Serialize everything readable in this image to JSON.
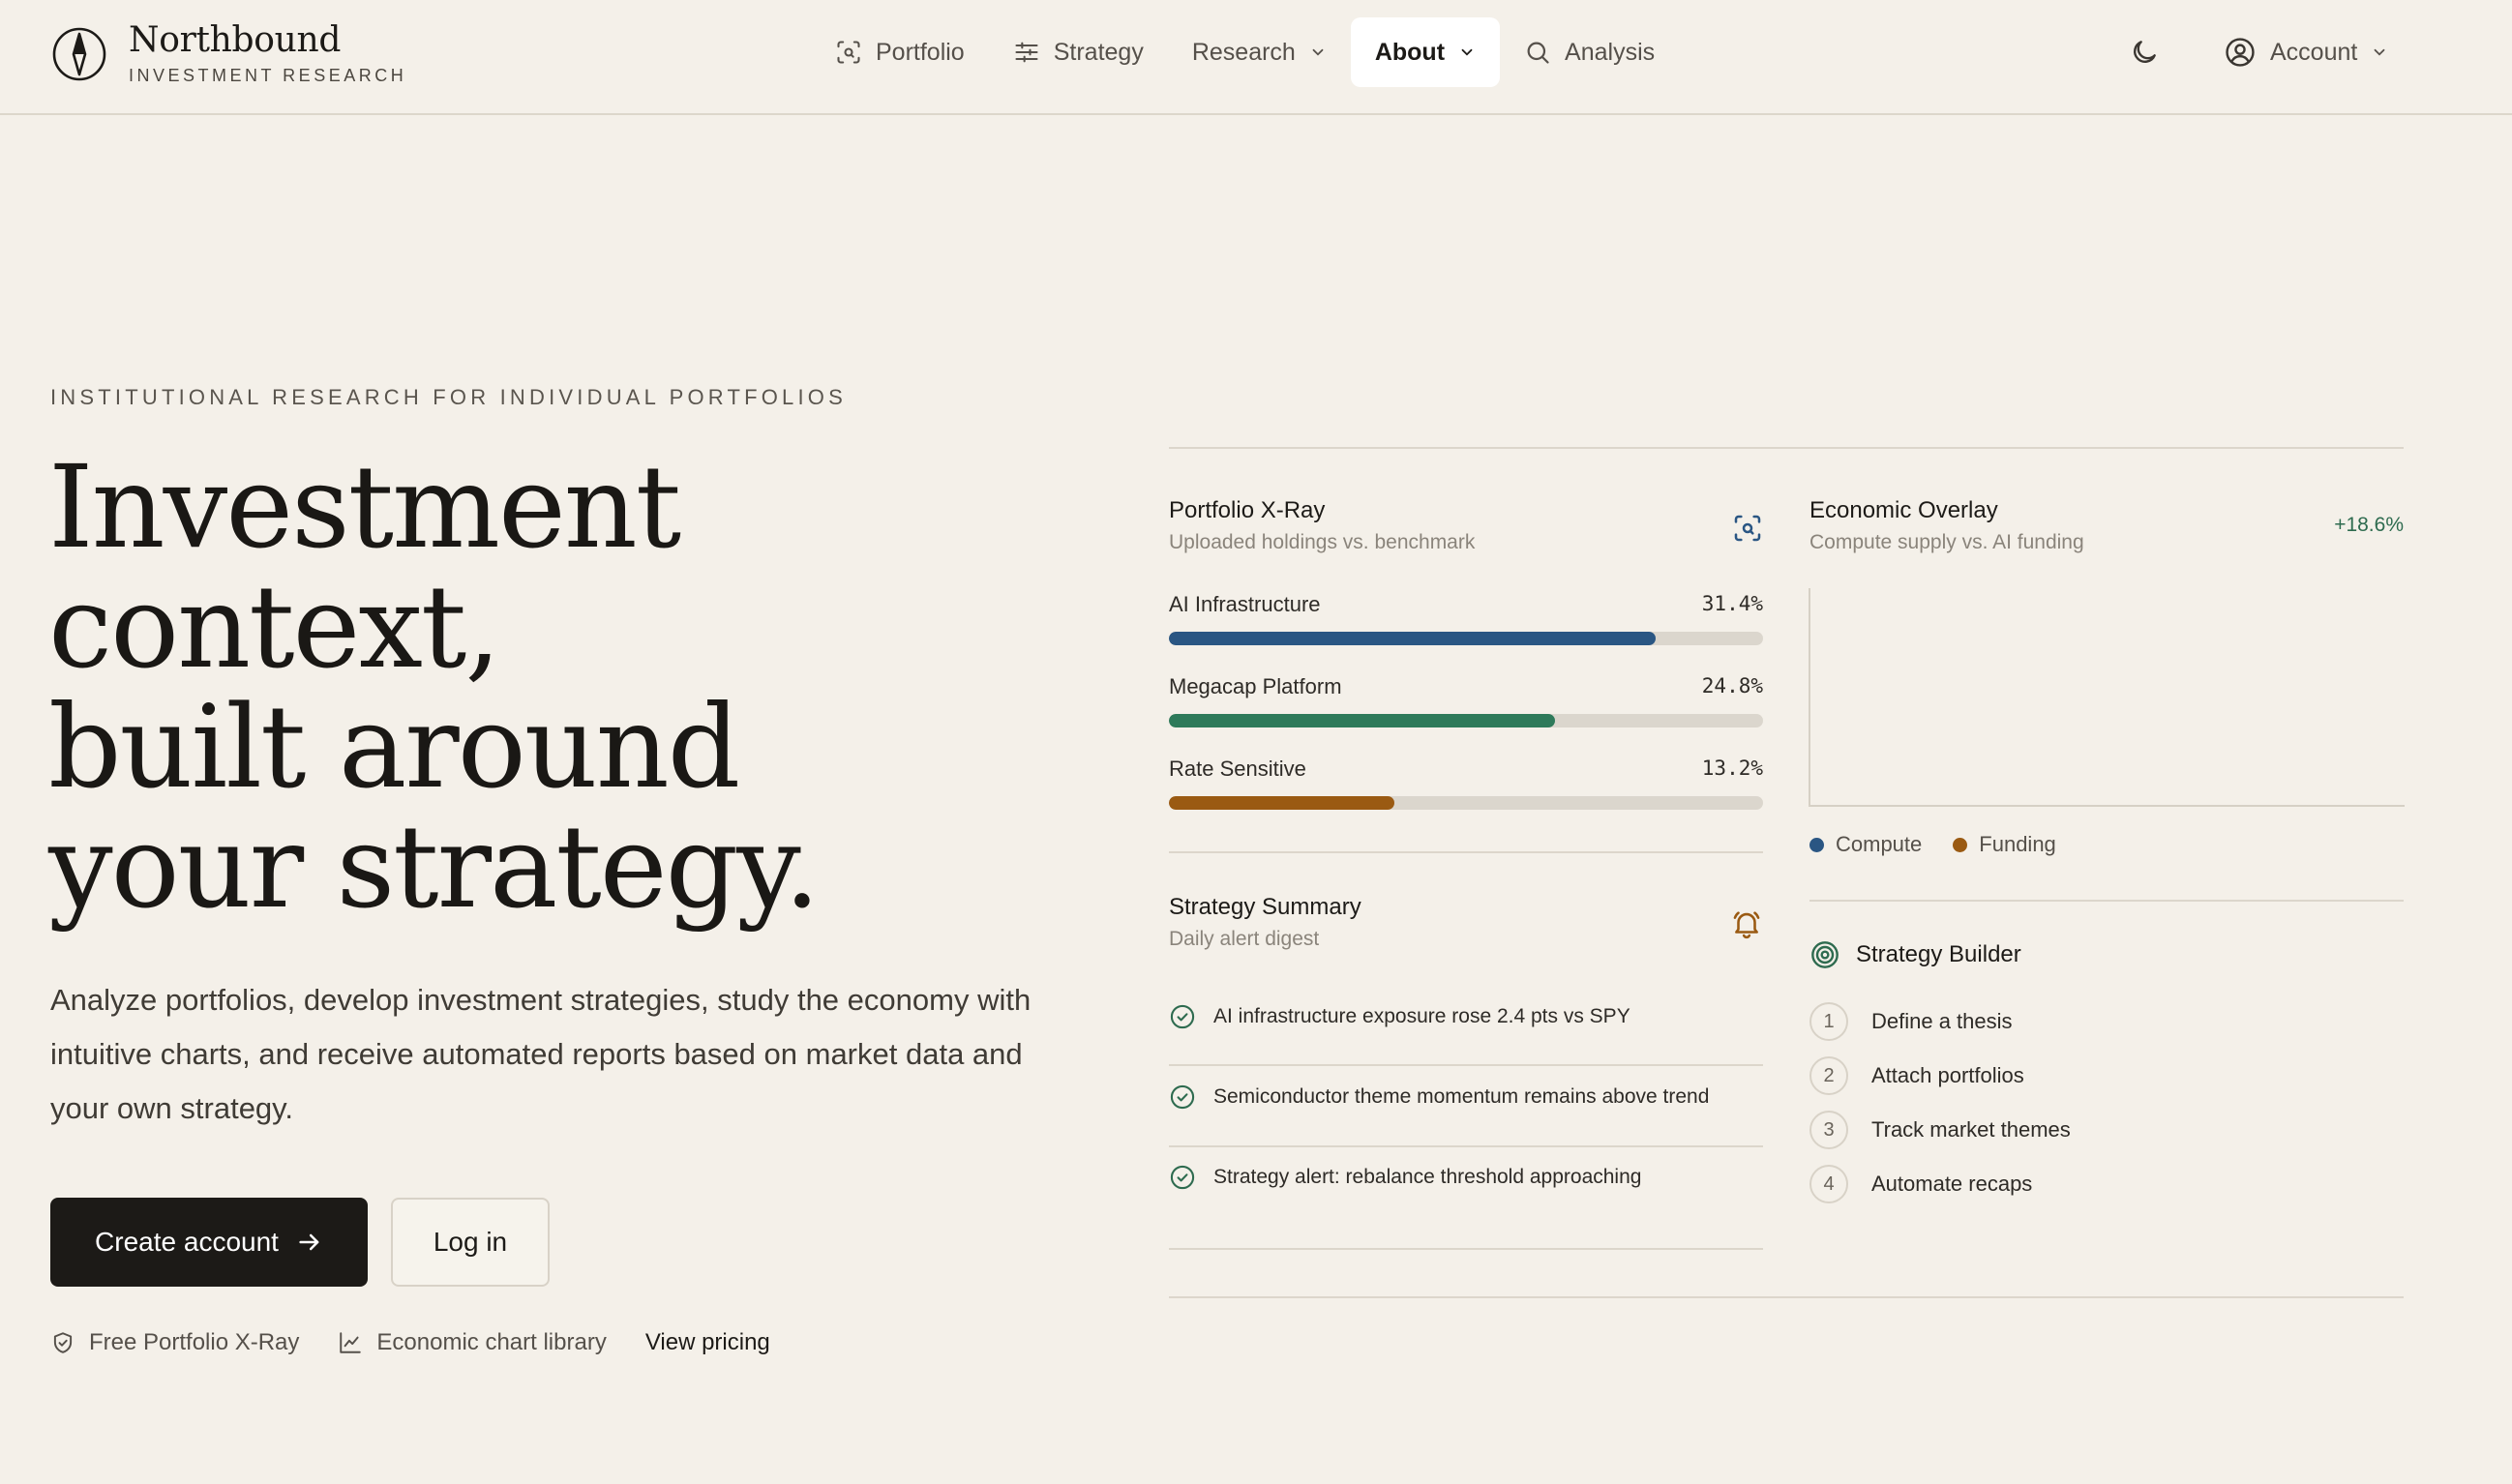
{
  "brand": {
    "name": "Northbound",
    "tagline": "INVESTMENT RESEARCH"
  },
  "nav": {
    "items": [
      {
        "label": "Portfolio",
        "icon": "scan-search-icon"
      },
      {
        "label": "Strategy",
        "icon": "sliders-icon"
      },
      {
        "label": "Research",
        "icon": "chevron-down-icon"
      },
      {
        "label": "About",
        "icon": "chevron-down-icon",
        "active": true
      },
      {
        "label": "Analysis",
        "icon": "search-icon"
      }
    ],
    "account_label": "Account"
  },
  "hero": {
    "eyebrow": "INSTITUTIONAL RESEARCH FOR INDIVIDUAL PORTFOLIOS",
    "headline_lines": [
      "Investment",
      "context,",
      "built around",
      "your strategy."
    ],
    "lede": "Analyze portfolios, develop investment strategies, study the economy with intuitive charts, and receive automated reports based on market data and your own strategy.",
    "primary_cta": "Create account",
    "secondary_cta": "Log in",
    "links": [
      "Free Portfolio X-Ray",
      "Economic chart library",
      "View pricing"
    ]
  },
  "xray": {
    "title": "Portfolio X-Ray",
    "subtitle": "Uploaded holdings vs. benchmark",
    "rows": [
      {
        "label": "AI Infrastructure",
        "value": "31.4%",
        "fill": 0.82,
        "color": "#2a5683"
      },
      {
        "label": "Megacap Platform",
        "value": "24.8%",
        "fill": 0.65,
        "color": "#2e7a5a"
      },
      {
        "label": "Rate Sensitive",
        "value": "13.2%",
        "fill": 0.38,
        "color": "#9a5a12"
      }
    ]
  },
  "overlay": {
    "title": "Economic Overlay",
    "subtitle": "Compute supply vs. AI funding",
    "change": "+18.6%",
    "legend": [
      {
        "name": "Compute",
        "color": "#2a5683"
      },
      {
        "name": "Funding",
        "color": "#9a5a12"
      }
    ]
  },
  "summary": {
    "title": "Strategy Summary",
    "subtitle": "Daily alert digest",
    "alerts": [
      "AI infrastructure exposure rose 2.4 pts vs SPY",
      "Semiconductor theme momentum remains above trend",
      "Strategy alert: rebalance threshold approaching"
    ]
  },
  "builder": {
    "title": "Strategy Builder",
    "steps": [
      {
        "num": "1",
        "label": "Define a thesis"
      },
      {
        "num": "2",
        "label": "Attach portfolios"
      },
      {
        "num": "3",
        "label": "Track market themes"
      },
      {
        "num": "4",
        "label": "Automate recaps"
      }
    ]
  },
  "colors": {
    "background": "#f4f0e9",
    "ink": "#1c1a17",
    "positive": "#2e6b4f",
    "accent_blue": "#2a5683",
    "accent_green": "#2e7a5a",
    "accent_amber": "#9a5a12"
  }
}
